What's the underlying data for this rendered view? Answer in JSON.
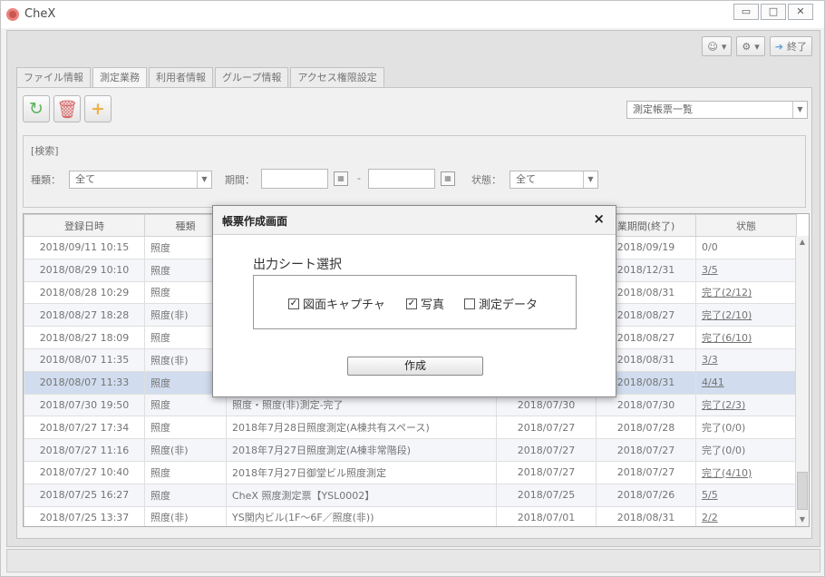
{
  "window": {
    "title": "CheX"
  },
  "toolbar": {
    "close_label": "終了"
  },
  "tabs": [
    {
      "label": "ファイル情報",
      "active": false
    },
    {
      "label": "測定業務",
      "active": true
    },
    {
      "label": "利用者情報",
      "active": false
    },
    {
      "label": "グループ情報",
      "active": false
    },
    {
      "label": "アクセス権限設定",
      "active": false
    }
  ],
  "view_select": {
    "value": "測定帳票一覧"
  },
  "search": {
    "title": "[検索]",
    "type_label": "種類：",
    "type_value": "全て",
    "period_label": "期間：",
    "period_sep": "-",
    "status_label": "状態：",
    "status_value": "全て"
  },
  "table": {
    "columns": [
      "登録日時",
      "種類",
      "",
      "",
      "業期間(終了)",
      "状態"
    ],
    "rows": [
      {
        "date": "2018/09/11 10:15",
        "type": "照度",
        "name": "",
        "start": "",
        "end": "2018/09/19",
        "status": "0/0"
      },
      {
        "date": "2018/08/29 10:10",
        "type": "照度",
        "name": "",
        "start": "",
        "end": "2018/12/31",
        "status": "3/5"
      },
      {
        "date": "2018/08/28 10:29",
        "type": "照度",
        "name": "",
        "start": "",
        "end": "2018/08/31",
        "status": "完了(2/12)"
      },
      {
        "date": "2018/08/27 18:28",
        "type": "照度(非)",
        "name": "",
        "start": "",
        "end": "2018/08/27",
        "status": "完了(2/10)"
      },
      {
        "date": "2018/08/27 18:09",
        "type": "照度",
        "name": "",
        "start": "",
        "end": "2018/08/27",
        "status": "完了(6/10)"
      },
      {
        "date": "2018/08/07 11:35",
        "type": "照度(非)",
        "name": "",
        "start": "",
        "end": "2018/08/31",
        "status": "3/3"
      },
      {
        "date": "2018/08/07 11:33",
        "type": "照度",
        "name": "",
        "start": "",
        "end": "2018/08/31",
        "status": "4/41"
      },
      {
        "date": "2018/07/30 19:50",
        "type": "照度",
        "name": "照度・照度(非)測定-完了",
        "start": "2018/07/30",
        "end": "2018/07/30",
        "status": "完了(2/3)"
      },
      {
        "date": "2018/07/27 17:34",
        "type": "照度",
        "name": "2018年7月28日照度測定(A棟共有スペース)",
        "start": "2018/07/27",
        "end": "2018/07/28",
        "status": "完了(0/0)"
      },
      {
        "date": "2018/07/27 11:16",
        "type": "照度(非)",
        "name": "2018年7月27日照度測定(A棟非常階段)",
        "start": "2018/07/27",
        "end": "2018/07/27",
        "status": "完了(0/0)"
      },
      {
        "date": "2018/07/27 10:40",
        "type": "照度",
        "name": "2018年7月27日御堂ビル照度測定",
        "start": "2018/07/27",
        "end": "2018/07/27",
        "status": "完了(4/10)"
      },
      {
        "date": "2018/07/25 16:27",
        "type": "照度",
        "name": "CheX 照度測定票【YSL0002】",
        "start": "2018/07/25",
        "end": "2018/07/26",
        "status": "5/5"
      },
      {
        "date": "2018/07/25 13:37",
        "type": "照度(非)",
        "name": "YS関内ビル(1F～6F／照度(非))",
        "start": "2018/07/01",
        "end": "2018/08/31",
        "status": "2/2"
      }
    ]
  },
  "dialog": {
    "title": "帳票作成画面",
    "close": "×",
    "section_label": "出力シート選択",
    "options": [
      {
        "label": "図面キャプチャ",
        "checked": true
      },
      {
        "label": "写真",
        "checked": true
      },
      {
        "label": "測定データ",
        "checked": false
      }
    ],
    "create_button": "作成"
  }
}
